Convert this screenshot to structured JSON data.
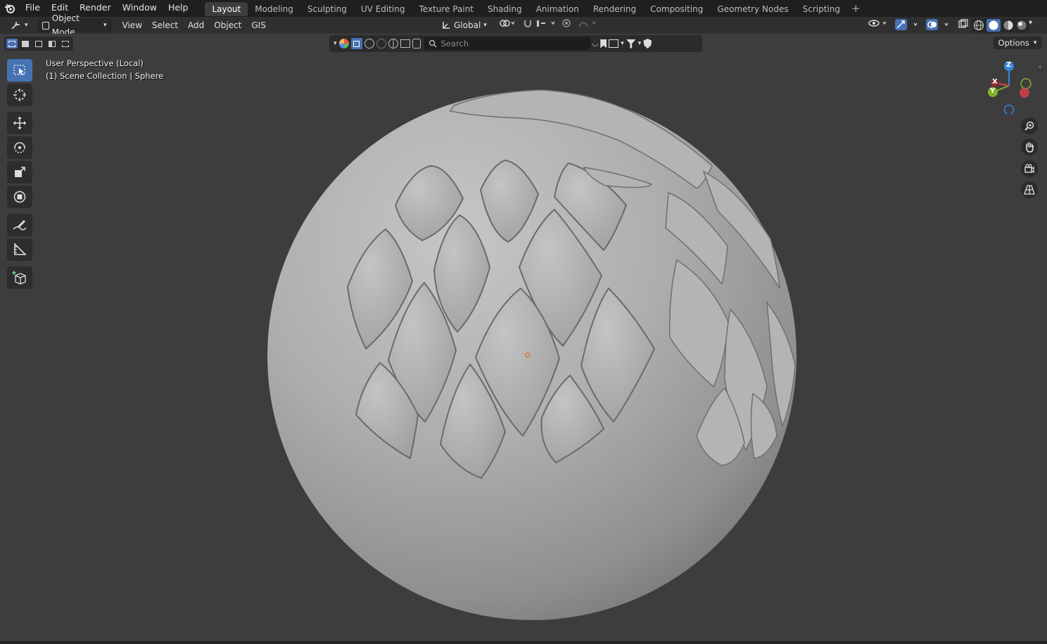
{
  "app_menu": {
    "items": [
      "File",
      "Edit",
      "Render",
      "Window",
      "Help"
    ]
  },
  "workspace_tabs": [
    "Layout",
    "Modeling",
    "Sculpting",
    "UV Editing",
    "Texture Paint",
    "Shading",
    "Animation",
    "Rendering",
    "Compositing",
    "Geometry Nodes",
    "Scripting"
  ],
  "active_tab": "Layout",
  "header": {
    "mode": "Object Mode",
    "view": "View",
    "select": "Select",
    "add": "Add",
    "object": "Object",
    "gis": "GIS",
    "orientation": "Global",
    "search_placeholder": "Search",
    "options": "Options"
  },
  "viewport_info": {
    "line1": "User Perspective (Local)",
    "line2": "(1) Scene Collection | Sphere"
  },
  "gizmo": {
    "z": "Z",
    "y": "Y",
    "x": "X"
  },
  "colors": {
    "accent": "#4772b3",
    "x_axis": "#e0414e",
    "y_axis": "#7eb02a",
    "z_axis": "#3a84d9",
    "origin": "#e07020"
  },
  "tools": [
    "select-box",
    "cursor",
    "move",
    "rotate",
    "scale",
    "transform",
    "annotate",
    "measure",
    "add-cube"
  ]
}
